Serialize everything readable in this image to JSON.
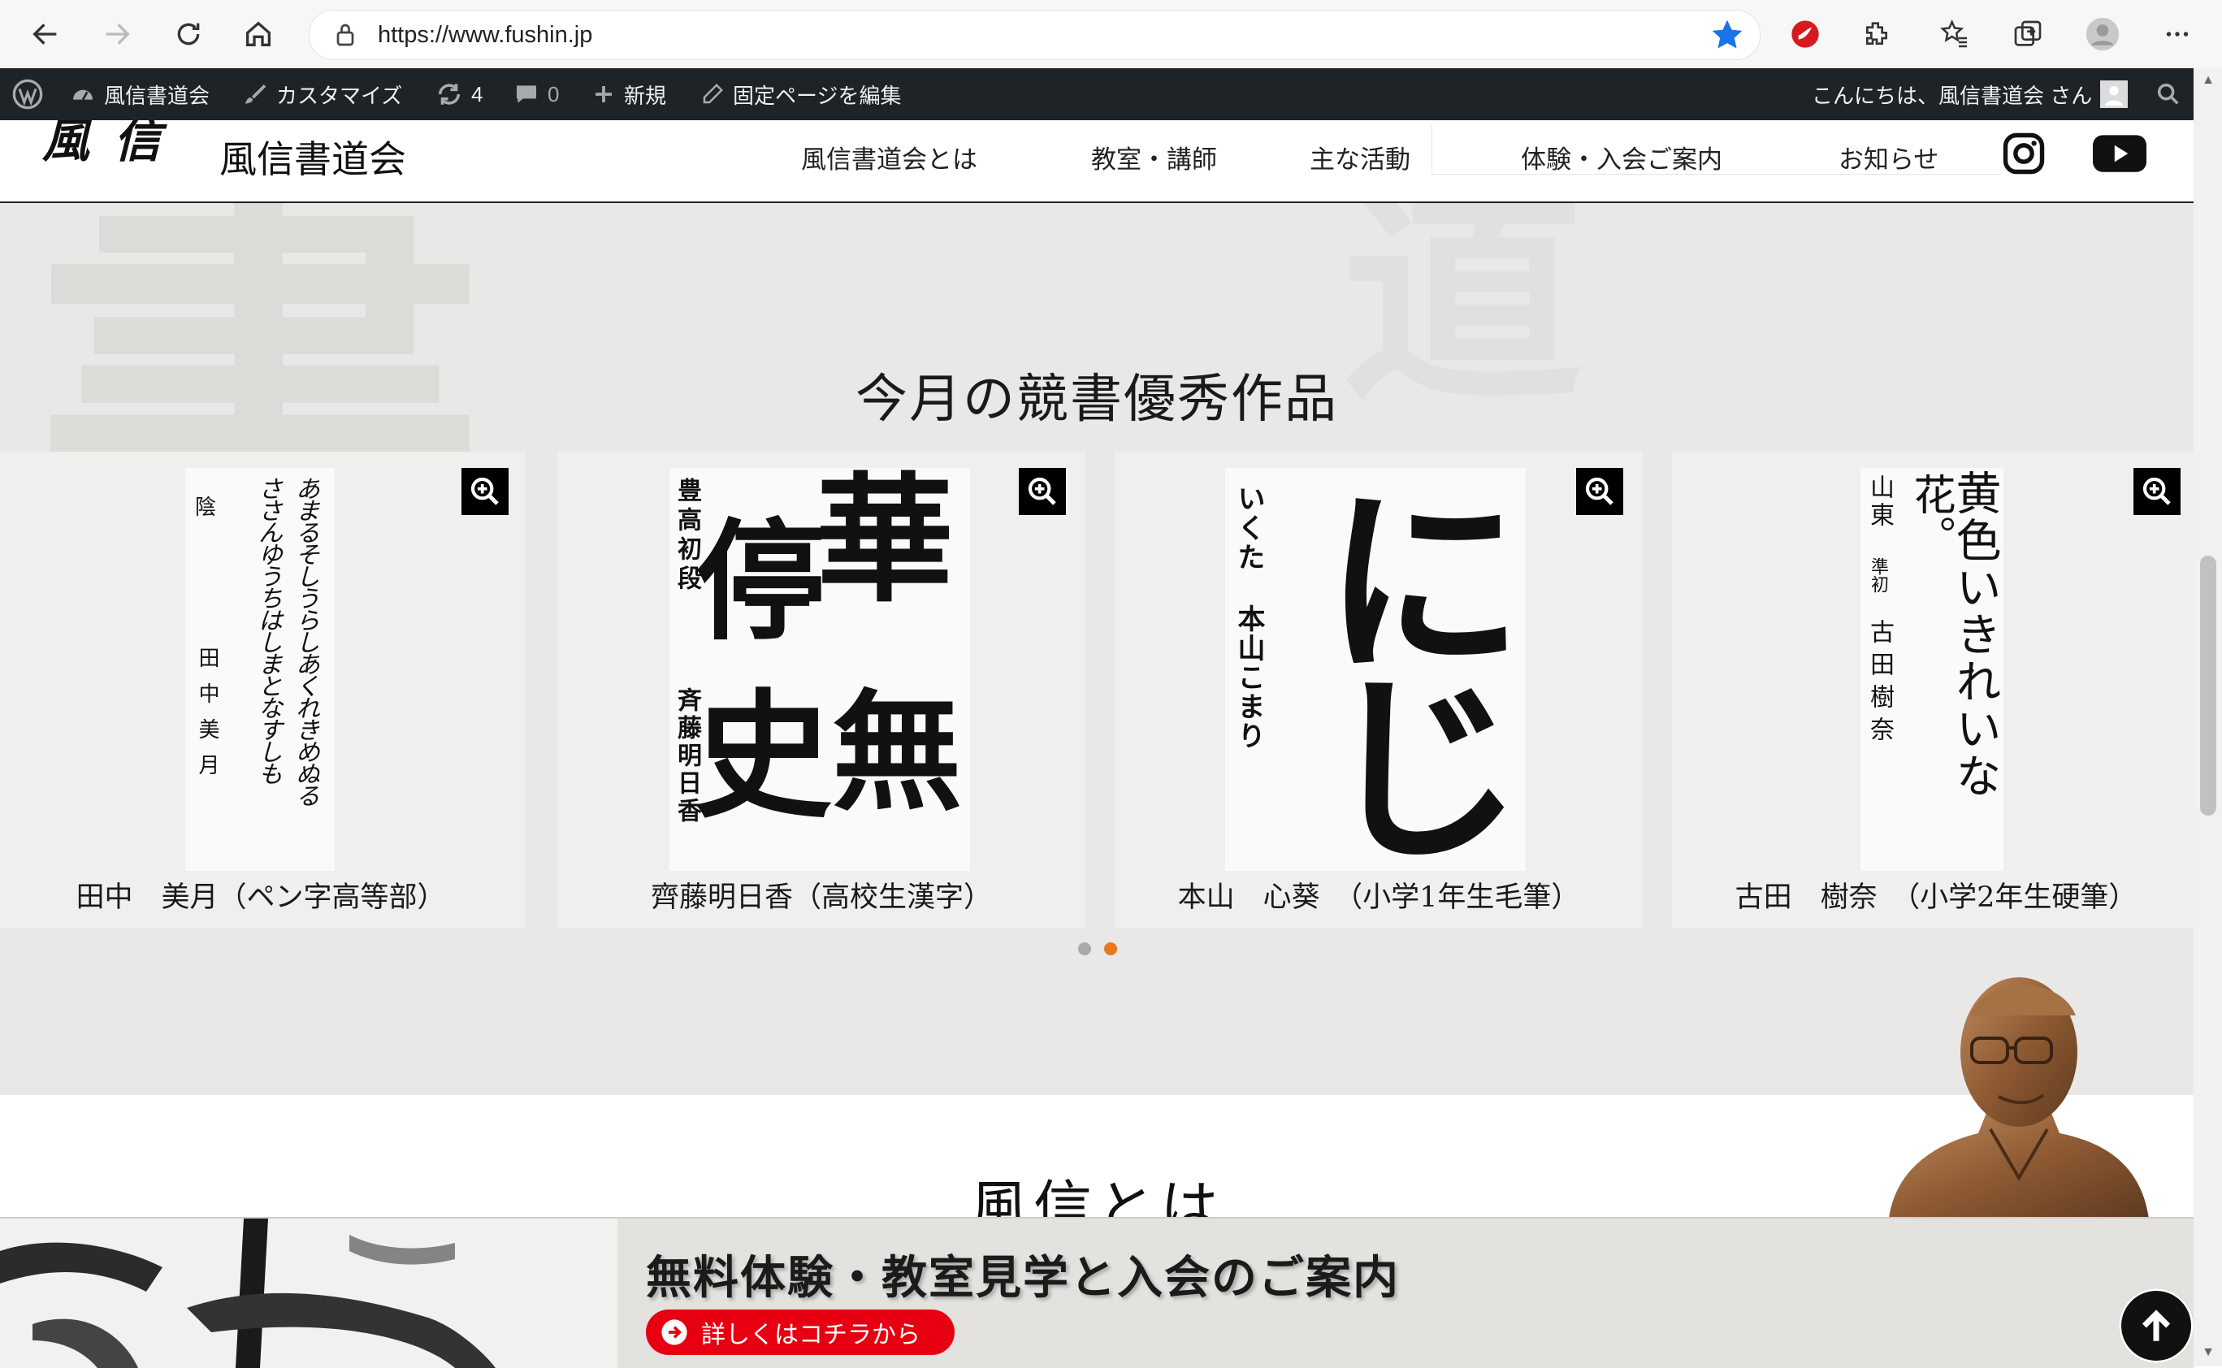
{
  "browser": {
    "url": "https://www.fushin.jp"
  },
  "admin_bar": {
    "site_name": "風信書道会",
    "customize": "カスタマイズ",
    "updates_count": "4",
    "comments_count": "0",
    "new": "新規",
    "edit_page": "固定ページを編集",
    "greeting": "こんにちは、風信書道会 さん"
  },
  "header": {
    "logo_mark": "風信",
    "site_title": "風信書道会",
    "nav": [
      "風信書道会とは",
      "教室・講師",
      "主な活動",
      "体験・入会ご案内",
      "お知らせ"
    ]
  },
  "works": {
    "title": "今月の競書優秀作品",
    "items": [
      {
        "caption": "田中　美月（ペン字高等部）",
        "lines": [
          "あまるそしうらしあくれきめぬる",
          "ささんゆうちはしまとなすしも"
        ],
        "small": [
          "陰",
          "田中美月"
        ]
      },
      {
        "caption": "齊藤明日香（高校生漢字）",
        "main": [
          "華",
          "無",
          "停",
          "史"
        ],
        "side": "豊高初段",
        "signature": "斉藤明日香"
      },
      {
        "caption": "本山　心葵　（小学1年生毛筆）",
        "main": "にじ",
        "side": "いくた",
        "signature": "本山こまり"
      },
      {
        "caption": "古田　樹奈　（小学2年生硬筆）",
        "line1": "黄色いきれいな",
        "line2": "花。",
        "side": "山東",
        "grade": "準初",
        "signature": "古田樹奈"
      }
    ],
    "active_dot": 2
  },
  "about": {
    "title": "風信とは"
  },
  "banner": {
    "heading": "無料体験・教室見学と入会のご案内",
    "button": "詳しくはコチラから"
  },
  "colors": {
    "admin_bar": "#1d2327",
    "banner_button": "#e60012",
    "active_dot": "#e87722",
    "star": "#1a73e8"
  }
}
